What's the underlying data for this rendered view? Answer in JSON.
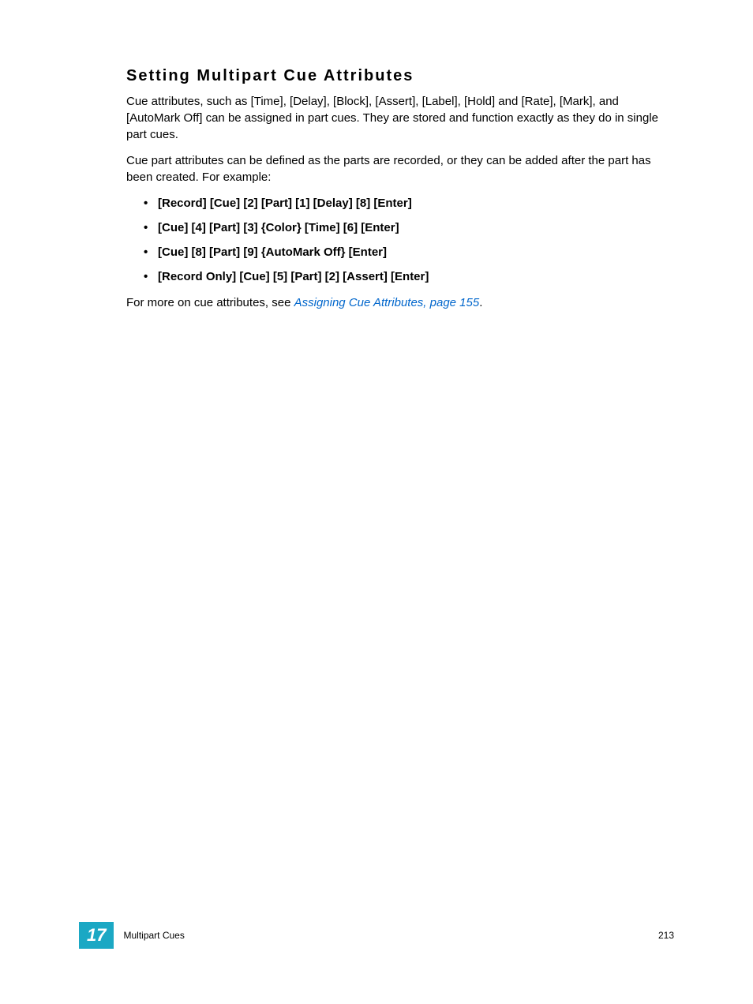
{
  "heading": "Setting Multipart Cue Attributes",
  "paragraph1": "Cue attributes, such as [Time], [Delay], [Block], [Assert], [Label], [Hold] and [Rate], [Mark], and [AutoMark Off] can be assigned in part cues. They are stored and function exactly as they do in single part cues.",
  "paragraph2": "Cue part attributes can be defined as the parts are recorded, or they can be added after the part has been created. For example:",
  "bullets": [
    "[Record] [Cue] [2] [Part] [1] [Delay] [8] [Enter]",
    "[Cue] [4] [Part] [3] {Color} [Time] [6] [Enter]",
    "[Cue] [8] [Part] [9] {AutoMark Off} [Enter]",
    "[Record Only] [Cue] [5] [Part] [2] [Assert] [Enter]"
  ],
  "paragraph3_prefix": "For more on cue attributes, see ",
  "paragraph3_link": "Assigning Cue Attributes, page 155",
  "paragraph3_suffix": ".",
  "footer": {
    "chapter_number": "17",
    "chapter_title": "Multipart Cues",
    "page_number": "213"
  }
}
